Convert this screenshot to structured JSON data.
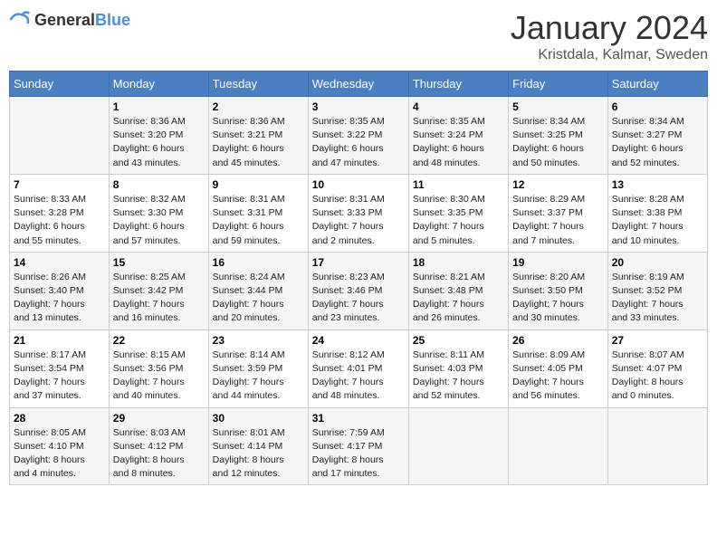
{
  "header": {
    "logo_general": "General",
    "logo_blue": "Blue",
    "month_title": "January 2024",
    "location": "Kristdala, Kalmar, Sweden"
  },
  "weekdays": [
    "Sunday",
    "Monday",
    "Tuesday",
    "Wednesday",
    "Thursday",
    "Friday",
    "Saturday"
  ],
  "weeks": [
    [
      {
        "day": "",
        "info": ""
      },
      {
        "day": "1",
        "info": "Sunrise: 8:36 AM\nSunset: 3:20 PM\nDaylight: 6 hours\nand 43 minutes."
      },
      {
        "day": "2",
        "info": "Sunrise: 8:36 AM\nSunset: 3:21 PM\nDaylight: 6 hours\nand 45 minutes."
      },
      {
        "day": "3",
        "info": "Sunrise: 8:35 AM\nSunset: 3:22 PM\nDaylight: 6 hours\nand 47 minutes."
      },
      {
        "day": "4",
        "info": "Sunrise: 8:35 AM\nSunset: 3:24 PM\nDaylight: 6 hours\nand 48 minutes."
      },
      {
        "day": "5",
        "info": "Sunrise: 8:34 AM\nSunset: 3:25 PM\nDaylight: 6 hours\nand 50 minutes."
      },
      {
        "day": "6",
        "info": "Sunrise: 8:34 AM\nSunset: 3:27 PM\nDaylight: 6 hours\nand 52 minutes."
      }
    ],
    [
      {
        "day": "7",
        "info": "Sunrise: 8:33 AM\nSunset: 3:28 PM\nDaylight: 6 hours\nand 55 minutes."
      },
      {
        "day": "8",
        "info": "Sunrise: 8:32 AM\nSunset: 3:30 PM\nDaylight: 6 hours\nand 57 minutes."
      },
      {
        "day": "9",
        "info": "Sunrise: 8:31 AM\nSunset: 3:31 PM\nDaylight: 6 hours\nand 59 minutes."
      },
      {
        "day": "10",
        "info": "Sunrise: 8:31 AM\nSunset: 3:33 PM\nDaylight: 7 hours\nand 2 minutes."
      },
      {
        "day": "11",
        "info": "Sunrise: 8:30 AM\nSunset: 3:35 PM\nDaylight: 7 hours\nand 5 minutes."
      },
      {
        "day": "12",
        "info": "Sunrise: 8:29 AM\nSunset: 3:37 PM\nDaylight: 7 hours\nand 7 minutes."
      },
      {
        "day": "13",
        "info": "Sunrise: 8:28 AM\nSunset: 3:38 PM\nDaylight: 7 hours\nand 10 minutes."
      }
    ],
    [
      {
        "day": "14",
        "info": "Sunrise: 8:26 AM\nSunset: 3:40 PM\nDaylight: 7 hours\nand 13 minutes."
      },
      {
        "day": "15",
        "info": "Sunrise: 8:25 AM\nSunset: 3:42 PM\nDaylight: 7 hours\nand 16 minutes."
      },
      {
        "day": "16",
        "info": "Sunrise: 8:24 AM\nSunset: 3:44 PM\nDaylight: 7 hours\nand 20 minutes."
      },
      {
        "day": "17",
        "info": "Sunrise: 8:23 AM\nSunset: 3:46 PM\nDaylight: 7 hours\nand 23 minutes."
      },
      {
        "day": "18",
        "info": "Sunrise: 8:21 AM\nSunset: 3:48 PM\nDaylight: 7 hours\nand 26 minutes."
      },
      {
        "day": "19",
        "info": "Sunrise: 8:20 AM\nSunset: 3:50 PM\nDaylight: 7 hours\nand 30 minutes."
      },
      {
        "day": "20",
        "info": "Sunrise: 8:19 AM\nSunset: 3:52 PM\nDaylight: 7 hours\nand 33 minutes."
      }
    ],
    [
      {
        "day": "21",
        "info": "Sunrise: 8:17 AM\nSunset: 3:54 PM\nDaylight: 7 hours\nand 37 minutes."
      },
      {
        "day": "22",
        "info": "Sunrise: 8:15 AM\nSunset: 3:56 PM\nDaylight: 7 hours\nand 40 minutes."
      },
      {
        "day": "23",
        "info": "Sunrise: 8:14 AM\nSunset: 3:59 PM\nDaylight: 7 hours\nand 44 minutes."
      },
      {
        "day": "24",
        "info": "Sunrise: 8:12 AM\nSunset: 4:01 PM\nDaylight: 7 hours\nand 48 minutes."
      },
      {
        "day": "25",
        "info": "Sunrise: 8:11 AM\nSunset: 4:03 PM\nDaylight: 7 hours\nand 52 minutes."
      },
      {
        "day": "26",
        "info": "Sunrise: 8:09 AM\nSunset: 4:05 PM\nDaylight: 7 hours\nand 56 minutes."
      },
      {
        "day": "27",
        "info": "Sunrise: 8:07 AM\nSunset: 4:07 PM\nDaylight: 8 hours\nand 0 minutes."
      }
    ],
    [
      {
        "day": "28",
        "info": "Sunrise: 8:05 AM\nSunset: 4:10 PM\nDaylight: 8 hours\nand 4 minutes."
      },
      {
        "day": "29",
        "info": "Sunrise: 8:03 AM\nSunset: 4:12 PM\nDaylight: 8 hours\nand 8 minutes."
      },
      {
        "day": "30",
        "info": "Sunrise: 8:01 AM\nSunset: 4:14 PM\nDaylight: 8 hours\nand 12 minutes."
      },
      {
        "day": "31",
        "info": "Sunrise: 7:59 AM\nSunset: 4:17 PM\nDaylight: 8 hours\nand 17 minutes."
      },
      {
        "day": "",
        "info": ""
      },
      {
        "day": "",
        "info": ""
      },
      {
        "day": "",
        "info": ""
      }
    ]
  ]
}
